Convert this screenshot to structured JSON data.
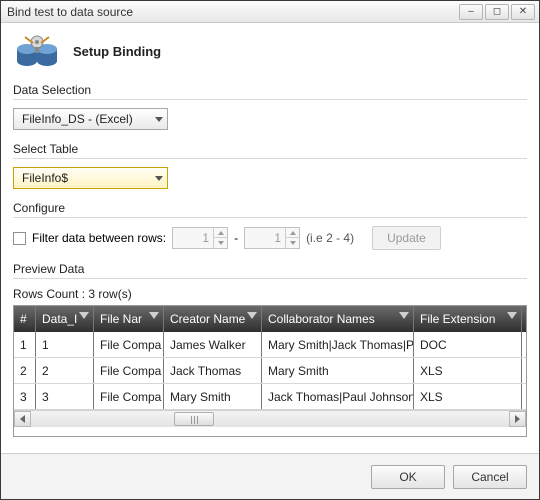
{
  "window": {
    "title": "Bind test to data source"
  },
  "header": {
    "title": "Setup Binding"
  },
  "data_selection": {
    "label": "Data Selection",
    "value": "FileInfo_DS - (Excel)"
  },
  "select_table": {
    "label": "Select Table",
    "value": "FileInfo$"
  },
  "configure": {
    "label": "Configure",
    "filter_label": "Filter data between rows:",
    "from": "1",
    "to": "1",
    "sep": "-",
    "hint": "(i.e 2 - 4)",
    "update_label": "Update"
  },
  "preview": {
    "label": "Preview Data",
    "rows_count_label": "Rows Count : 3 row(s)",
    "columns": [
      "#",
      "Data_I",
      "File Nar",
      "Creator Name",
      "Collaborator Names",
      "File Extension"
    ],
    "rows": [
      {
        "idx": "1",
        "data_id": "1",
        "file_name": "File Compa",
        "creator": "James Walker",
        "collab": "Mary Smith|Jack Thomas|Pa",
        "ext": "DOC"
      },
      {
        "idx": "2",
        "data_id": "2",
        "file_name": "File Compa",
        "creator": "Jack Thomas",
        "collab": "Mary Smith",
        "ext": "XLS"
      },
      {
        "idx": "3",
        "data_id": "3",
        "file_name": "File Compa",
        "creator": "Mary Smith",
        "collab": "Jack Thomas|Paul Johnson",
        "ext": "XLS"
      }
    ]
  },
  "footer": {
    "ok": "OK",
    "cancel": "Cancel"
  }
}
